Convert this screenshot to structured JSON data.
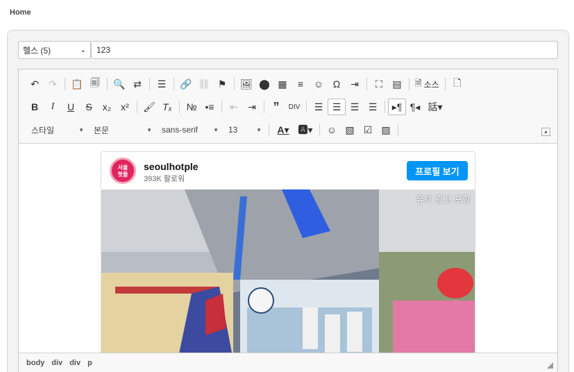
{
  "header": {
    "title": "Home"
  },
  "form": {
    "category_value": "헬스 (5)",
    "title_value": "123"
  },
  "toolbar": {
    "row1": [
      "undo-icon",
      "redo-icon",
      "paste-text-icon",
      "paste-word-icon",
      "find-icon",
      "replace-icon",
      "templates-icon",
      "link-icon",
      "unlink-icon",
      "anchor-icon",
      "image-icon",
      "flash-icon",
      "table-icon",
      "horizontal-rule-icon",
      "smiley-icon",
      "special-char-icon",
      "page-break-icon",
      "maximize-icon",
      "show-blocks-icon",
      "source-icon",
      "new-page-icon"
    ],
    "source_label": "소스",
    "style_label": "스타일",
    "format_label": "본문",
    "font_label": "sans-serif",
    "size_label": "13"
  },
  "embed": {
    "username": "seoulhotple",
    "followers": "393K 팔로워",
    "profile_button": "프로필 보기",
    "ad_label": "유료 광고 포함",
    "avatar_text": "서울 핫플"
  },
  "statusbar": {
    "path": [
      "body",
      "div",
      "div",
      "p"
    ]
  },
  "colors": {
    "accent": "#0095f6",
    "avatar": "#e0245e"
  }
}
